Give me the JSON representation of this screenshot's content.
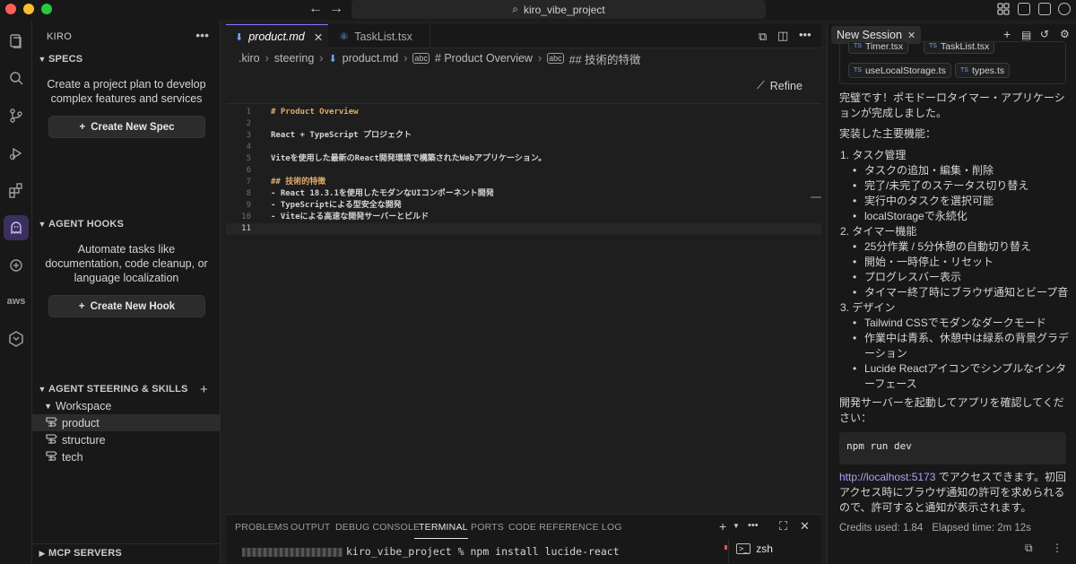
{
  "window": {
    "title": "kiro_vibe_project"
  },
  "sidebar": {
    "title": "KIRO",
    "specs": {
      "header": "SPECS",
      "description": "Create a project plan to develop complex features and services",
      "button": "Create New Spec"
    },
    "hooks": {
      "header": "AGENT HOOKS",
      "description": "Automate tasks like documentation, code cleanup, or language localization",
      "button": "Create New Hook"
    },
    "steering": {
      "header": "AGENT STEERING & SKILLS",
      "group": "Workspace",
      "items": [
        "product",
        "structure",
        "tech"
      ]
    },
    "mcp": {
      "header": "MCP SERVERS"
    }
  },
  "editor": {
    "tabs": [
      {
        "label": "product.md",
        "active": true
      },
      {
        "label": "TaskList.tsx",
        "active": false
      }
    ],
    "breadcrumb": [
      ".kiro",
      "steering",
      "product.md",
      "# Product Overview",
      "## 技術的特徴"
    ],
    "refine_label": "Refine",
    "lines": [
      {
        "n": "1",
        "text": "# Product Overview"
      },
      {
        "n": "2",
        "text": ""
      },
      {
        "n": "3",
        "text": "React + TypeScript プロジェクト"
      },
      {
        "n": "4",
        "text": ""
      },
      {
        "n": "5",
        "text": "Viteを使用した最新のReact開発環境で構築されたWebアプリケーション。"
      },
      {
        "n": "6",
        "text": ""
      },
      {
        "n": "7",
        "text": "## 技術的特徴"
      },
      {
        "n": "8",
        "text": "- React 18.3.1を使用したモダンなUIコンポーネント開発"
      },
      {
        "n": "9",
        "text": "- TypeScriptによる型安全な開発"
      },
      {
        "n": "10",
        "text": "- Viteによる高速な開発サーバーとビルド"
      },
      {
        "n": "11",
        "text": ""
      }
    ]
  },
  "panel": {
    "tabs": [
      "PROBLEMS",
      "OUTPUT",
      "DEBUG CONSOLE",
      "TERMINAL",
      "PORTS",
      "CODE REFERENCE LOG"
    ],
    "active_tab": "TERMINAL",
    "terminal_line": "kiro_vibe_project % npm install lucide-react",
    "terminal_list": [
      "zsh"
    ]
  },
  "chat": {
    "tab_label": "New Session",
    "file_chips": [
      "Timer.tsx",
      "TaskList.tsx",
      "useLocalStorage.ts",
      "types.ts"
    ],
    "intro": "完璧です！ポモドーロタイマー・アプリケーションが完成しました。",
    "features_heading": "実装した主要機能：",
    "sections": [
      {
        "title": "1. タスク管理",
        "items": [
          "タスクの追加・編集・削除",
          "完了/未完了のステータス切り替え",
          "実行中のタスクを選択可能",
          "localStorageで永続化"
        ]
      },
      {
        "title": "2. タイマー機能",
        "items": [
          "25分作業 / 5分休憩の自動切り替え",
          "開始・一時停止・リセット",
          "プログレスバー表示",
          "タイマー終了時にブラウザ通知とビープ音"
        ]
      },
      {
        "title": "3. デザイン",
        "items": [
          "Tailwind CSSでモダンなダークモード",
          "作業中は青系、休憩中は緑系の背景グラデーション",
          "Lucide Reactアイコンでシンプルなインターフェース"
        ]
      }
    ],
    "dev_text": "開発サーバーを起動してアプリを確認してください：",
    "command": "npm run dev",
    "link": "http://localhost:5173",
    "link_suffix": " でアクセスできます。初回アクセス時にブラウザ通知の許可を求められるので、許可すると通知が表示されます。",
    "credits": "Credits used: 1.84",
    "elapsed": "Elapsed time: 2m 12s"
  },
  "colors": {
    "accent": "#8a74ff",
    "link": "#b39dff",
    "markdown_heading": "#e0aa6e"
  }
}
